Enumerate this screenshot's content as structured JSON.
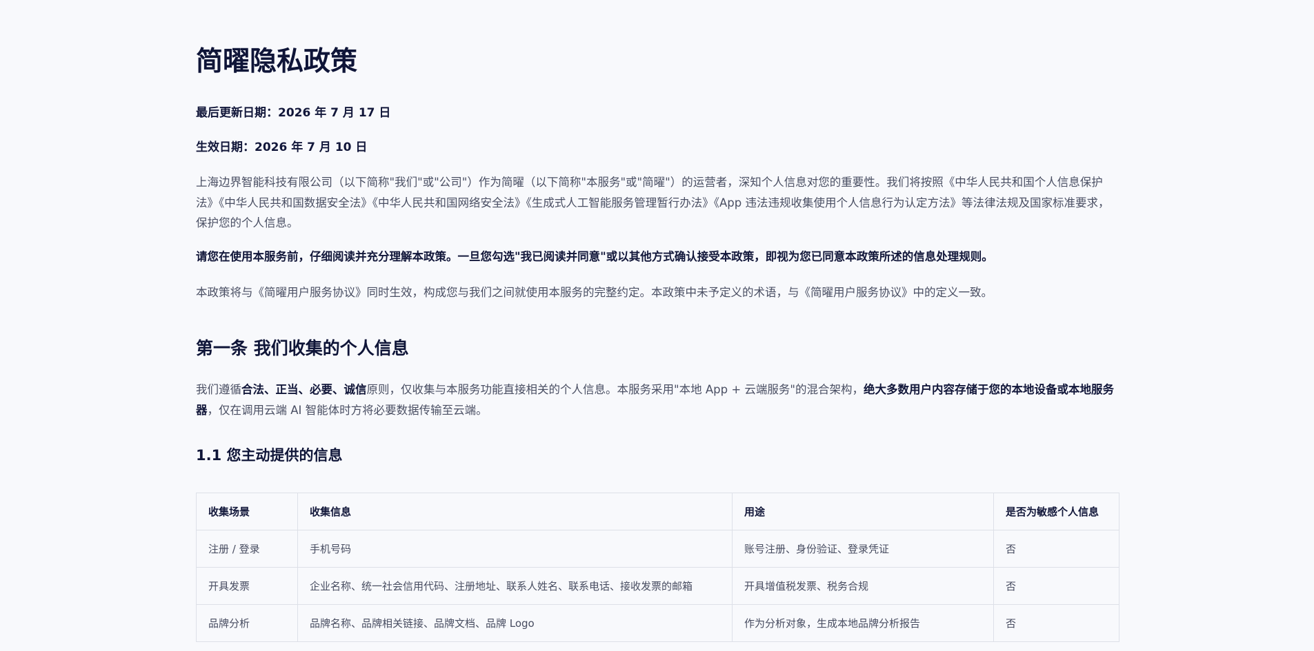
{
  "document": {
    "title": "简曜隐私政策",
    "last_updated": "最后更新日期：2026 年 7 月 17 日",
    "effective": "生效日期：2026 年 7 月 10 日",
    "intro": "上海边界智能科技有限公司（以下简称\"我们\"或\"公司\"）作为简曜（以下简称\"本服务\"或\"简曜\"）的运营者，深知个人信息对您的重要性。我们将按照《中华人民共和国个人信息保护法》《中华人民共和国数据安全法》《中华人民共和国网络安全法》《生成式人工智能服务管理暂行办法》《App 违法违规收集使用个人信息行为认定方法》等法律法规及国家标准要求，保护您的个人信息。",
    "notice": "请您在使用本服务前，仔细阅读并充分理解本政策。一旦您勾选\"我已阅读并同意\"或以其他方式确认接受本政策，即视为您已同意本政策所述的信息处理规则。",
    "relation": "本政策将与《简曜用户服务协议》同时生效，构成您与我们之间就使用本服务的完整约定。本政策中未予定义的术语，与《简曜用户服务协议》中的定义一致。"
  },
  "section1": {
    "heading": "第一条 我们收集的个人信息",
    "principle": {
      "p1": "我们遵循",
      "b1": "合法、正当、必要、诚信",
      "p2": "原则，仅收集与本服务功能直接相关的个人信息。本服务采用\"本地 App + 云端服务\"的混合架构，",
      "b2": "绝大多数用户内容存储于您的本地设备或本地服务器",
      "p3": "，仅在调用云端 AI 智能体时方将必要数据传输至云端。"
    },
    "subsection": {
      "heading": "1.1 您主动提供的信息",
      "table": {
        "headers": [
          "收集场景",
          "收集信息",
          "用途",
          "是否为敏感个人信息"
        ],
        "rows": [
          [
            "注册 / 登录",
            "手机号码",
            "账号注册、身份验证、登录凭证",
            "否"
          ],
          [
            "开具发票",
            "企业名称、统一社会信用代码、注册地址、联系人姓名、联系电话、接收发票的邮箱",
            "开具增值税发票、税务合规",
            "否"
          ],
          [
            "品牌分析",
            "品牌名称、品牌相关链接、品牌文档、品牌 Logo",
            "作为分析对象，生成本地品牌分析报告",
            "否"
          ]
        ]
      }
    }
  }
}
